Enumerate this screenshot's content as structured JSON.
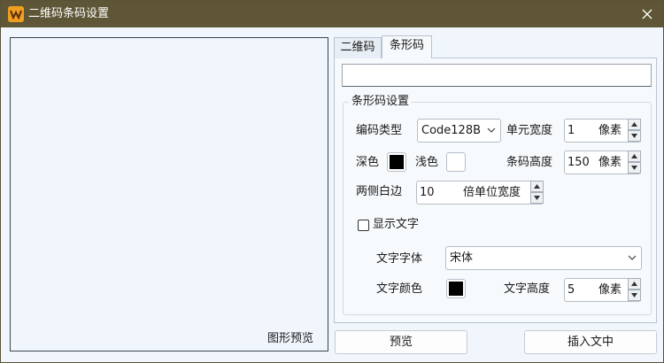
{
  "window": {
    "title": "二维码条码设置",
    "titlebar_color": "#5e5637",
    "icon": "app-logo-icon",
    "close_icon": "close-icon"
  },
  "preview": {
    "label": "图形预览"
  },
  "tabs": [
    {
      "label": "二维码",
      "active": false
    },
    {
      "label": "条形码",
      "active": true
    }
  ],
  "barcode": {
    "data_value": "",
    "group_title": "条形码设置",
    "encoding_type": {
      "label": "编码类型",
      "value": "Code128B"
    },
    "unit_width": {
      "label": "单元宽度",
      "value": "1",
      "unit": "像素"
    },
    "dark_color": {
      "label": "深色",
      "color": "#000000"
    },
    "light_color": {
      "label": "浅色",
      "color": "#ffffff"
    },
    "bar_height": {
      "label": "条码高度",
      "value": "150",
      "unit": "像素"
    },
    "quiet_zone": {
      "label": "两侧白边",
      "value": "10",
      "unit": "倍单位宽度"
    },
    "show_text": {
      "label": "显示文字",
      "checked": false
    },
    "text_font": {
      "label": "文字字体",
      "value": "宋体"
    },
    "text_color": {
      "label": "文字颜色",
      "color": "#000000"
    },
    "text_height": {
      "label": "文字高度",
      "value": "5",
      "unit": "像素"
    }
  },
  "buttons": {
    "preview": "预览",
    "insert": "插入文中"
  }
}
